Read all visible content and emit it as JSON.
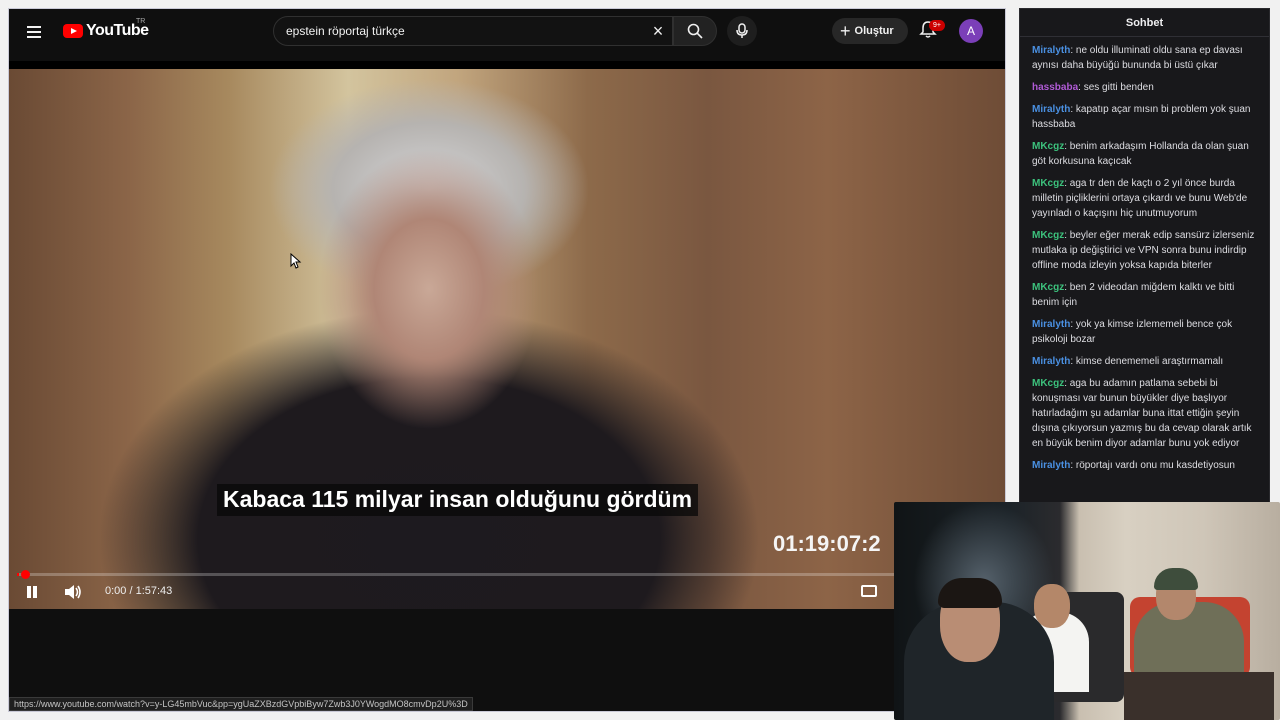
{
  "masthead": {
    "logo_text": "YouTube",
    "region": "TR",
    "search_value": "epstein röportaj türkçe",
    "create_label": "Oluştur",
    "notification_count": "9+",
    "avatar_letter": "A"
  },
  "player": {
    "subtitle": "Kabaca 115 milyar insan olduğunu gördüm",
    "burned_timecode": "01:19:07:2",
    "time_display": "0:00 / 1:57:43",
    "progress_fraction": 0.002
  },
  "status_url": "https://www.youtube.com/watch?v=y-LG45mbVuc&pp=ygUaZXBzdGVpbiByw7Zwb3J0YWogdMO8cmvDp2U%3D",
  "chat": {
    "title": "Sohbet",
    "messages": [
      {
        "user": "Miralyth",
        "color": "#4a90e2",
        "text": "ne oldu illuminati oldu sana ep davası aynısı daha büyüğü bununda bi üstü çıkar"
      },
      {
        "user": "hassbaba",
        "color": "#b05bd6",
        "text": "ses gitti benden"
      },
      {
        "user": "Miralyth",
        "color": "#4a90e2",
        "text": "kapatıp açar mısın bi problem yok şuan hassbaba"
      },
      {
        "user": "MKcgz",
        "color": "#3cc27d",
        "text": "benim arkadaşım Hollanda da olan şuan göt korkusuna kaçıcak"
      },
      {
        "user": "MKcgz",
        "color": "#3cc27d",
        "text": "aga tr den de kaçtı o 2 yıl önce burda milletin piçliklerini ortaya çıkardı ve bunu Web'de yayınladı o kaçışını hiç unutmuyorum"
      },
      {
        "user": "MKcgz",
        "color": "#3cc27d",
        "text": "beyler eğer merak edip sansürz izlerseniz mutlaka ip değiştirici ve VPN sonra bunu indirdip offline moda izleyin yoksa kapıda biterler"
      },
      {
        "user": "MKcgz",
        "color": "#3cc27d",
        "text": "ben 2 videodan miğdem kalktı ve bitti benim için"
      },
      {
        "user": "Miralyth",
        "color": "#4a90e2",
        "text": "yok ya kimse izlememeli bence çok psikoloji bozar"
      },
      {
        "user": "Miralyth",
        "color": "#4a90e2",
        "text": "kimse denememeli araştırmamalı"
      },
      {
        "user": "MKcgz",
        "color": "#3cc27d",
        "text": "aga bu adamın patlama sebebi bi konuşması var bunun büyükler diye başlıyor hatırladağım şu adamlar buna ittat ettiğin şeyin dışına çıkıyorsun yazmış bu da cevap olarak artık en büyük benim diyor adamlar bunu yok ediyor"
      },
      {
        "user": "Miralyth",
        "color": "#4a90e2",
        "text": "röportajı vardı onu mu kasdetiyosun"
      }
    ]
  },
  "colors": {
    "accent": "#ff0000",
    "background": "#0f0f0f",
    "chat_bg": "#18181b"
  },
  "icons": [
    "menu-icon",
    "youtube-logo-icon",
    "clear-icon",
    "search-icon",
    "mic-icon",
    "plus-icon",
    "bell-icon",
    "pause-icon",
    "volume-icon",
    "captions-icon",
    "cursor-icon"
  ]
}
